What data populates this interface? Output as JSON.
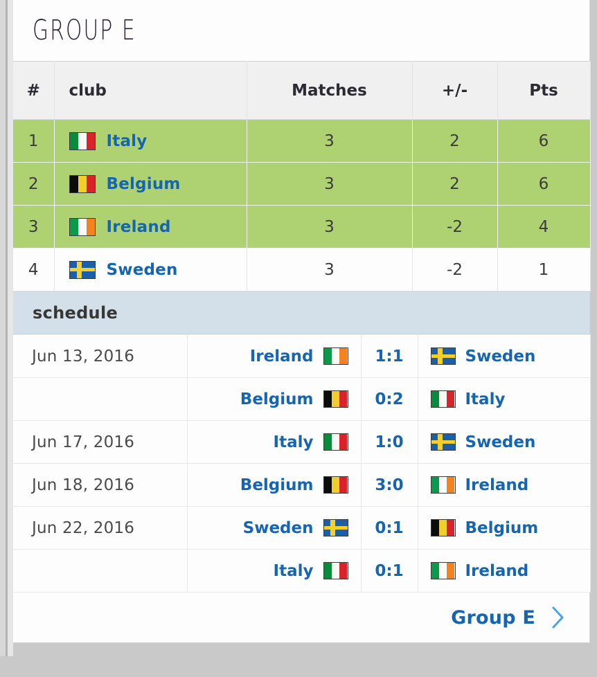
{
  "page": {
    "title": "Group E"
  },
  "standings": {
    "columns": [
      "#",
      "club",
      "Matches",
      "+/-",
      "Pts"
    ],
    "rows": [
      {
        "rank": "1",
        "club": "Italy",
        "flag": "italy-flag",
        "matches": "3",
        "diff": "2",
        "pts": "6",
        "qualified": true
      },
      {
        "rank": "2",
        "club": "Belgium",
        "flag": "belgium-flag",
        "matches": "3",
        "diff": "2",
        "pts": "6",
        "qualified": true
      },
      {
        "rank": "3",
        "club": "Ireland",
        "flag": "ireland-flag",
        "matches": "3",
        "diff": "-2",
        "pts": "4",
        "qualified": true
      },
      {
        "rank": "4",
        "club": "Sweden",
        "flag": "sweden-flag",
        "matches": "3",
        "diff": "-2",
        "pts": "1",
        "qualified": false
      }
    ]
  },
  "schedule": {
    "label": "schedule",
    "matches": [
      {
        "date": "Jun 13, 2016",
        "home": "Ireland",
        "home_flag": "ireland-flag",
        "score": "1:1",
        "away": "Sweden",
        "away_flag": "sweden-flag"
      },
      {
        "date": "",
        "home": "Belgium",
        "home_flag": "belgium-flag",
        "score": "0:2",
        "away": "Italy",
        "away_flag": "italy-flag"
      },
      {
        "date": "Jun 17, 2016",
        "home": "Italy",
        "home_flag": "italy-flag",
        "score": "1:0",
        "away": "Sweden",
        "away_flag": "sweden-flag"
      },
      {
        "date": "Jun 18, 2016",
        "home": "Belgium",
        "home_flag": "belgium-flag",
        "score": "3:0",
        "away": "Ireland",
        "away_flag": "ireland-flag"
      },
      {
        "date": "Jun 22, 2016",
        "home": "Sweden",
        "home_flag": "sweden-flag",
        "score": "0:1",
        "away": "Belgium",
        "away_flag": "belgium-flag"
      },
      {
        "date": "",
        "home": "Italy",
        "home_flag": "italy-flag",
        "score": "0:1",
        "away": "Ireland",
        "away_flag": "ireland-flag"
      }
    ]
  },
  "footer": {
    "link_label": "Group E",
    "chevron_icon": "chevron-right-icon"
  },
  "colors": {
    "qualified_row": "#aed172",
    "schedule_band": "#d4e0e9",
    "link_blue": "#1565b0",
    "chevron_blue": "#4aa3e0",
    "header_bg": "#f0f0f0",
    "page_bg": "#c9c9c9"
  }
}
